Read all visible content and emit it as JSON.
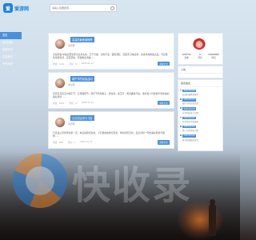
{
  "header": {
    "logo_text": "爱游网",
    "logo_mark": "爱",
    "search_placeholder": "请输入您要搜索…"
  },
  "sidebar": {
    "items": [
      {
        "label": "首页"
      },
      {
        "label": "美文阅读"
      },
      {
        "label": "情感日记"
      },
      {
        "label": "生活常识"
      },
      {
        "label": "节气传说"
      }
    ]
  },
  "posts": [
    {
      "title": "高温防暑食谱推荐",
      "author": "命行网",
      "date": "2025-01-15",
      "body": "高温防暑 中暑主要表现为头晕头痛、口干舌燥、高热不退、面色潮红、四肢无力等症状。多食清热解暑之品，可适量饮用绿豆汤、菊花茶等，有助降温消暑……",
      "views": "阅读：1121",
      "comments": "评论：6",
      "readmore": "阅读全文"
    },
    {
      "title": "端午节的民俗活动",
      "author": "命行网",
      "date": "2025-01-14",
      "body": "农历五月初五为端午节，又称端阳节。端午节有吃粽子、赛龙舟、挂艾草、佩香囊等习俗，寄托着人们祈求平安健康的美好愿望……",
      "views": "阅读：1007",
      "comments": "评论：0",
      "readmore": "阅读全文"
    },
    {
      "title": "元旦的由来与习俗",
      "author": "命行网",
      "date": "2025-01-13",
      "body": "元旦是公历新年的第一天，象征着辞旧迎新。人们通常会张灯结彩、举办庆祝活动，表达对新一年的美好祝愿与期盼……",
      "views": "阅读：984",
      "comments": "评论：2",
      "readmore": "阅读全文"
    }
  ],
  "profile": {
    "stats": [
      {
        "n": "108752",
        "label": "文章"
      },
      {
        "n": "0",
        "label": "评论"
      },
      {
        "n": "2266868",
        "label": "浏览"
      }
    ]
  },
  "notice": {
    "title": "公告"
  },
  "recent": {
    "title": "最近发表",
    "items": [
      {
        "date": "2025/01/15",
        "text": "高温防暑食谱推荐"
      },
      {
        "date": "2025/01/14",
        "text": "端午节的民俗活动"
      },
      {
        "date": "2025/01/13",
        "text": "元旦的由来与习俗"
      },
      {
        "date": "2025/01/12",
        "text": "冬至吃饺子的寓意"
      },
      {
        "date": "2025/01/11",
        "text": "腊八节的传统习俗"
      },
      {
        "date": "2025/01/10",
        "text": "春节贴春联的讲究"
      }
    ]
  },
  "watermark": {
    "text": "快收录"
  },
  "colors": {
    "accent": "#4a90d9",
    "brand": "#1d83d6"
  }
}
